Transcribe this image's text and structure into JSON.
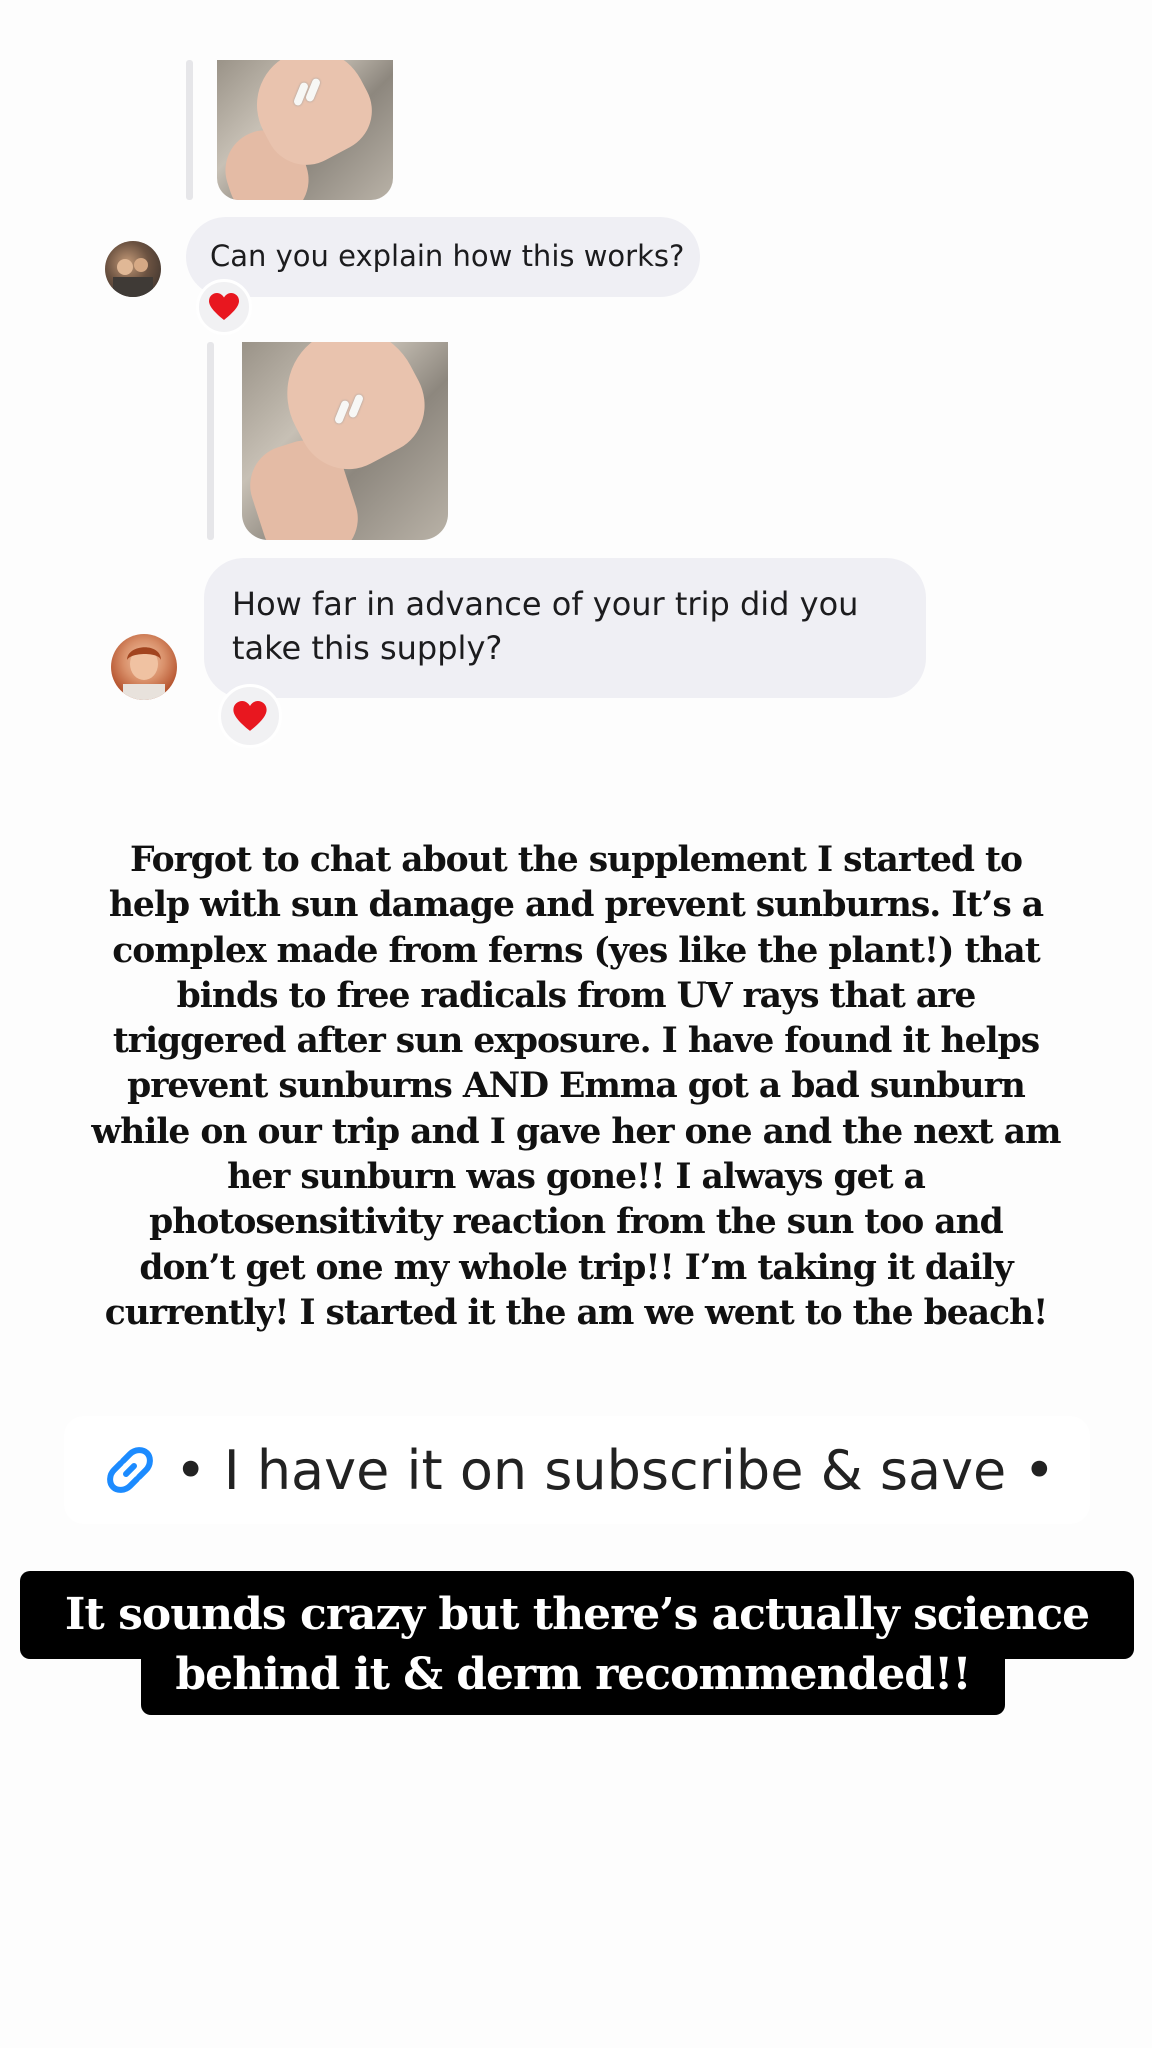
{
  "messages": [
    {
      "text": "Can you explain how this works?",
      "reaction": "heart"
    },
    {
      "text": "How far in advance of your trip did you take this supply?",
      "line1": "How far in advance of your trip did you",
      "line2": "take this supply?",
      "reaction": "heart"
    }
  ],
  "story_lines": [
    "Forgot to chat about the supplement I started to",
    "help with sun damage and prevent sunburns. It’s a",
    "complex made from ferns (yes like the plant!) that",
    "binds to free radicals from UV rays that are",
    "triggered after sun exposure. I have found it helps",
    "prevent sunburns AND Emma got a bad sunburn",
    "while on our trip and I gave her one and the next am",
    "her sunburn was gone!! I always get a",
    "photosensitivity reaction from the sun too and",
    "don’t get one my whole trip!! I’m taking it daily",
    "currently! I started it the am we went to the beach!"
  ],
  "link_sticker": {
    "icon": "link-icon",
    "text": "• I have it on subscribe & save •"
  },
  "caption": {
    "line1": "It sounds crazy but there’s actually science",
    "line2": "behind it & derm recommended!!"
  },
  "colors": {
    "bubble": "#efeff4",
    "link_icon": "#1c8bff",
    "heart": "#e8171f",
    "caption_bg": "#000000"
  }
}
